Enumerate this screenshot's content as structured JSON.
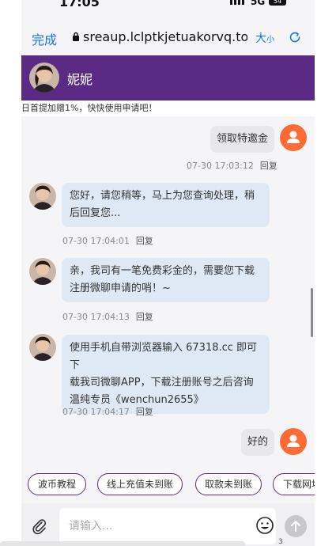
{
  "status": {
    "time": "17:05",
    "network": "5G",
    "battery": "54"
  },
  "browser": {
    "done_label": "完成",
    "url": "sreaup.lclptkjetuakorvq.top",
    "text_size_big": "大",
    "text_size_small": "小"
  },
  "chat": {
    "agent_name": "妮妮",
    "notice": "日首提加赠1%，快快使用申请吧！"
  },
  "messages": [
    {
      "from": "user",
      "text": "领取特邀金",
      "time": "07-30 17:03:12",
      "reply": "回复"
    },
    {
      "from": "agent",
      "lines": [
        "您好，请您稍等，马上为您查询处理，稍",
        "后回复您..."
      ],
      "time": "07-30 17:04:01",
      "reply": "回复"
    },
    {
      "from": "agent",
      "lines": [
        "亲，我司有一笔免费彩金的，需要您下载",
        "注册微聊申请的哨！~"
      ],
      "time": "07-30 17:04:13",
      "reply": "回复"
    },
    {
      "from": "agent",
      "lines": [
        "使用手机自带浏览器输入 67318.cc 即可下",
        "载我司微聊APP，下载注册账号之后咨询",
        "温纯专员《wenchun2655》"
      ],
      "time": "07-30 17:04:17",
      "reply": "回复"
    },
    {
      "from": "user",
      "text": "好的",
      "time": "",
      "reply": ""
    }
  ],
  "quick_replies": [
    "波币教程",
    "线上充值未到账",
    "取款未到账",
    "下载网址"
  ],
  "composer": {
    "placeholder": "请输入..."
  },
  "page_count": "3"
}
